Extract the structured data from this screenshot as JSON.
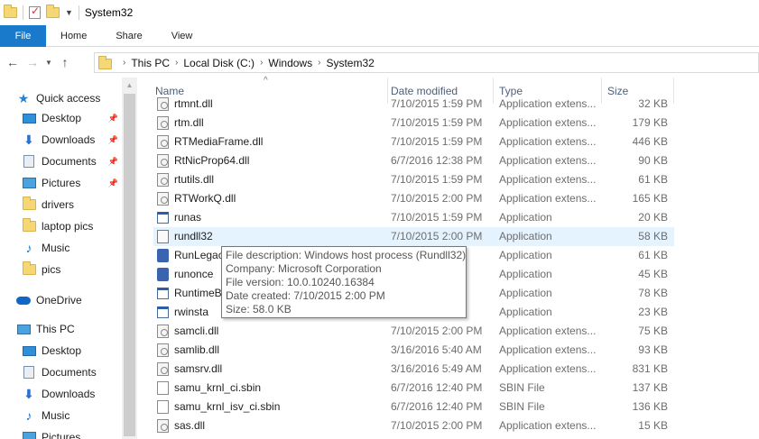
{
  "window": {
    "title": "System32"
  },
  "ribbon": {
    "tabs": [
      "File",
      "Home",
      "Share",
      "View"
    ]
  },
  "address": {
    "crumbs": [
      "This PC",
      "Local Disk (C:)",
      "Windows",
      "System32"
    ]
  },
  "nav": {
    "quick_access": "Quick access",
    "items": [
      {
        "label": "Desktop",
        "icon": "desktop-icon",
        "pinned": true
      },
      {
        "label": "Downloads",
        "icon": "downloads-icon",
        "pinned": true
      },
      {
        "label": "Documents",
        "icon": "documents-icon",
        "pinned": true
      },
      {
        "label": "Pictures",
        "icon": "pictures-icon",
        "pinned": true
      },
      {
        "label": "drivers",
        "icon": "folder-icon",
        "pinned": false
      },
      {
        "label": "laptop pics",
        "icon": "folder-icon",
        "pinned": false
      },
      {
        "label": "Music",
        "icon": "music-icon",
        "pinned": false
      },
      {
        "label": "pics",
        "icon": "folder-icon",
        "pinned": false
      }
    ],
    "onedrive": "OneDrive",
    "this_pc": "This PC",
    "pc_items": [
      {
        "label": "Desktop",
        "icon": "desktop-icon"
      },
      {
        "label": "Documents",
        "icon": "documents-icon"
      },
      {
        "label": "Downloads",
        "icon": "downloads-icon"
      },
      {
        "label": "Music",
        "icon": "music-icon"
      },
      {
        "label": "Pictures",
        "icon": "pictures-icon"
      }
    ]
  },
  "columns": {
    "name": "Name",
    "date": "Date modified",
    "type": "Type",
    "size": "Size"
  },
  "files": [
    {
      "name": "rtmnt.dll",
      "date": "7/10/2015 1:59 PM",
      "type": "Application extens...",
      "size": "32 KB",
      "kind": "dll"
    },
    {
      "name": "rtm.dll",
      "date": "7/10/2015 1:59 PM",
      "type": "Application extens...",
      "size": "179 KB",
      "kind": "dll"
    },
    {
      "name": "RTMediaFrame.dll",
      "date": "7/10/2015 1:59 PM",
      "type": "Application extens...",
      "size": "446 KB",
      "kind": "dll"
    },
    {
      "name": "RtNicProp64.dll",
      "date": "6/7/2016 12:38 PM",
      "type": "Application extens...",
      "size": "90 KB",
      "kind": "dll"
    },
    {
      "name": "rtutils.dll",
      "date": "7/10/2015 1:59 PM",
      "type": "Application extens...",
      "size": "61 KB",
      "kind": "dll"
    },
    {
      "name": "RTWorkQ.dll",
      "date": "7/10/2015 2:00 PM",
      "type": "Application extens...",
      "size": "165 KB",
      "kind": "dll"
    },
    {
      "name": "runas",
      "date": "7/10/2015 1:59 PM",
      "type": "Application",
      "size": "20 KB",
      "kind": "app"
    },
    {
      "name": "rundll32",
      "date": "7/10/2015 2:00 PM",
      "type": "Application",
      "size": "58 KB",
      "kind": "rundll",
      "selected": true
    },
    {
      "name": "RunLegac",
      "date": "",
      "type": "Application",
      "size": "61 KB",
      "kind": "special"
    },
    {
      "name": "runonce",
      "date": "",
      "type": "Application",
      "size": "45 KB",
      "kind": "special"
    },
    {
      "name": "RuntimeB",
      "date": "",
      "type": "Application",
      "size": "78 KB",
      "kind": "app"
    },
    {
      "name": "rwinsta",
      "date": "",
      "type": "Application",
      "size": "23 KB",
      "kind": "app"
    },
    {
      "name": "samcli.dll",
      "date": "7/10/2015 2:00 PM",
      "type": "Application extens...",
      "size": "75 KB",
      "kind": "dll"
    },
    {
      "name": "samlib.dll",
      "date": "3/16/2016 5:40 AM",
      "type": "Application extens...",
      "size": "93 KB",
      "kind": "dll"
    },
    {
      "name": "samsrv.dll",
      "date": "3/16/2016 5:49 AM",
      "type": "Application extens...",
      "size": "831 KB",
      "kind": "dll"
    },
    {
      "name": "samu_krnl_ci.sbin",
      "date": "6/7/2016 12:40 PM",
      "type": "SBIN File",
      "size": "137 KB",
      "kind": "sbin"
    },
    {
      "name": "samu_krnl_isv_ci.sbin",
      "date": "6/7/2016 12:40 PM",
      "type": "SBIN File",
      "size": "136 KB",
      "kind": "sbin"
    },
    {
      "name": "sas.dll",
      "date": "7/10/2015 2:00 PM",
      "type": "Application extens...",
      "size": "15 KB",
      "kind": "dll"
    }
  ],
  "tooltip": {
    "description": "File description: Windows host process (Rundll32)",
    "company": "Company: Microsoft Corporation",
    "version": "File version: 10.0.10240.16384",
    "created": "Date created: 7/10/2015 2:00 PM",
    "size": "Size: 58.0 KB"
  }
}
